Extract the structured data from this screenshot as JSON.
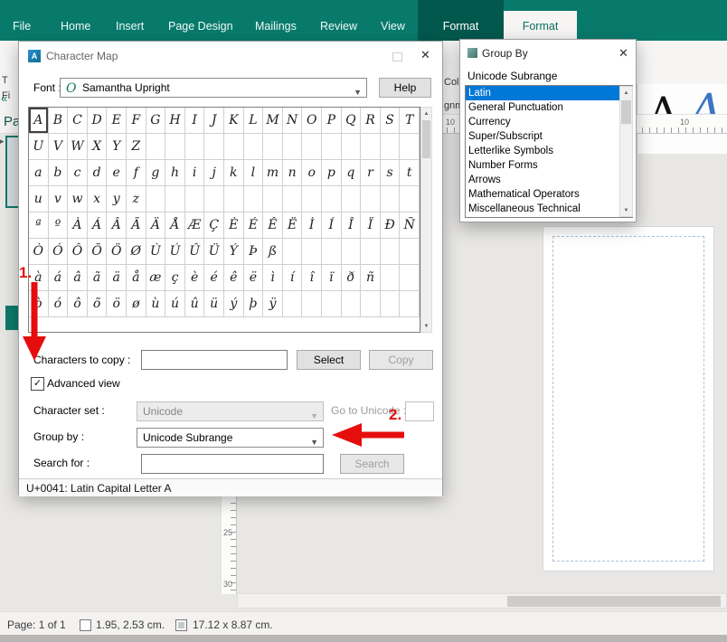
{
  "ribbon": {
    "tabs": [
      "File",
      "Home",
      "Insert",
      "Page Design",
      "Mailings",
      "Review",
      "View"
    ],
    "contextual_tab": "Format",
    "active_tab": "Format",
    "fragments": {
      "t": "T",
      "fi": "Fi",
      "col": "Col",
      "gnm": "gnm"
    },
    "font_preview": {
      "black_letter": "A",
      "blue_letter": "A"
    }
  },
  "panels": {
    "pages_title": "Pa"
  },
  "rulers": {
    "h_label_left": "10",
    "h_label_right": "10",
    "v_label_25": "25",
    "v_label_30": "30"
  },
  "charmap": {
    "title": "Character Map",
    "font_label": "Font :",
    "font_value": "Samantha Upright",
    "help_button": "Help",
    "grid_rows": [
      [
        "A",
        "B",
        "C",
        "D",
        "E",
        "F",
        "G",
        "H",
        "I",
        "J",
        "K",
        "L",
        "M",
        "N",
        "O",
        "P",
        "Q",
        "R",
        "S",
        "T"
      ],
      [
        "U",
        "V",
        "W",
        "X",
        "Y",
        "Z",
        "",
        "",
        "",
        "",
        "",
        "",
        "",
        "",
        "",
        "",
        "",
        "",
        "",
        ""
      ],
      [
        "a",
        "b",
        "c",
        "d",
        "e",
        "f",
        "g",
        "h",
        "i",
        "j",
        "k",
        "l",
        "m",
        "n",
        "o",
        "p",
        "q",
        "r",
        "s",
        "t"
      ],
      [
        "u",
        "v",
        "w",
        "x",
        "y",
        "z",
        "",
        "",
        "",
        "",
        "",
        "",
        "",
        "",
        "",
        "",
        "",
        "",
        "",
        ""
      ],
      [
        "ª",
        "º",
        "À",
        "Á",
        "Â",
        "Ã",
        "Ä",
        "Å",
        "Æ",
        "Ç",
        "È",
        "É",
        "Ê",
        "Ë",
        "Ì",
        "Í",
        "Î",
        "Ï",
        "Ð",
        "Ñ"
      ],
      [
        "Ò",
        "Ó",
        "Ô",
        "Õ",
        "Ö",
        "Ø",
        "Ù",
        "Ú",
        "Û",
        "Ü",
        "Ý",
        "Þ",
        "ß",
        "",
        "",
        "",
        "",
        "",
        "",
        ""
      ],
      [
        "à",
        "á",
        "â",
        "ã",
        "ä",
        "å",
        "æ",
        "ç",
        "è",
        "é",
        "ê",
        "ë",
        "ì",
        "í",
        "î",
        "ï",
        "ð",
        "ñ",
        "",
        ""
      ],
      [
        "ò",
        "ó",
        "ô",
        "õ",
        "ö",
        "ø",
        "ù",
        "ú",
        "û",
        "ü",
        "ý",
        "þ",
        "ÿ",
        "",
        "",
        "",
        "",
        "",
        "",
        ""
      ]
    ],
    "selected_char": "A",
    "copy_label": "Characters to copy :",
    "copy_value": "",
    "select_button": "Select",
    "copy_button": "Copy",
    "advanced_view_label": "Advanced view",
    "character_set_label": "Character set :",
    "character_set_value": "Unicode",
    "goto_unicode_label": "Go to Unicode :",
    "goto_unicode_value": "",
    "group_by_label": "Group by :",
    "group_by_value": "Unicode Subrange",
    "search_label": "Search for :",
    "search_value": "",
    "search_button": "Search",
    "status_text": "U+0041: Latin Capital Letter A"
  },
  "groupby_dialog": {
    "title": "Group By",
    "header": "Unicode Subrange",
    "items": [
      "Latin",
      "General Punctuation",
      "Currency",
      "Super/Subscript",
      "Letterlike Symbols",
      "Number Forms",
      "Arrows",
      "Mathematical Operators",
      "Miscellaneous Technical"
    ],
    "selected": "Latin"
  },
  "annotations": {
    "step1": "1.",
    "step2": "2."
  },
  "statusbar": {
    "page": "Page: 1 of 1",
    "position": "1.95, 2.53 cm.",
    "size": "17.12 x  8.87 cm."
  },
  "icons": {
    "close": "✕",
    "chevron_down": "▼",
    "check": "✓",
    "scroll_up": "▲",
    "scroll_down": "▼",
    "font_type": "O",
    "collapse": "«",
    "panel_arrow": "▸"
  },
  "colors": {
    "ribbon_teal": "#087a6c",
    "ribbon_dark_teal": "#03584d",
    "selection_blue": "#0078d7",
    "annotation_red": "#e60d0d",
    "preview_blue": "#3e74c4"
  }
}
